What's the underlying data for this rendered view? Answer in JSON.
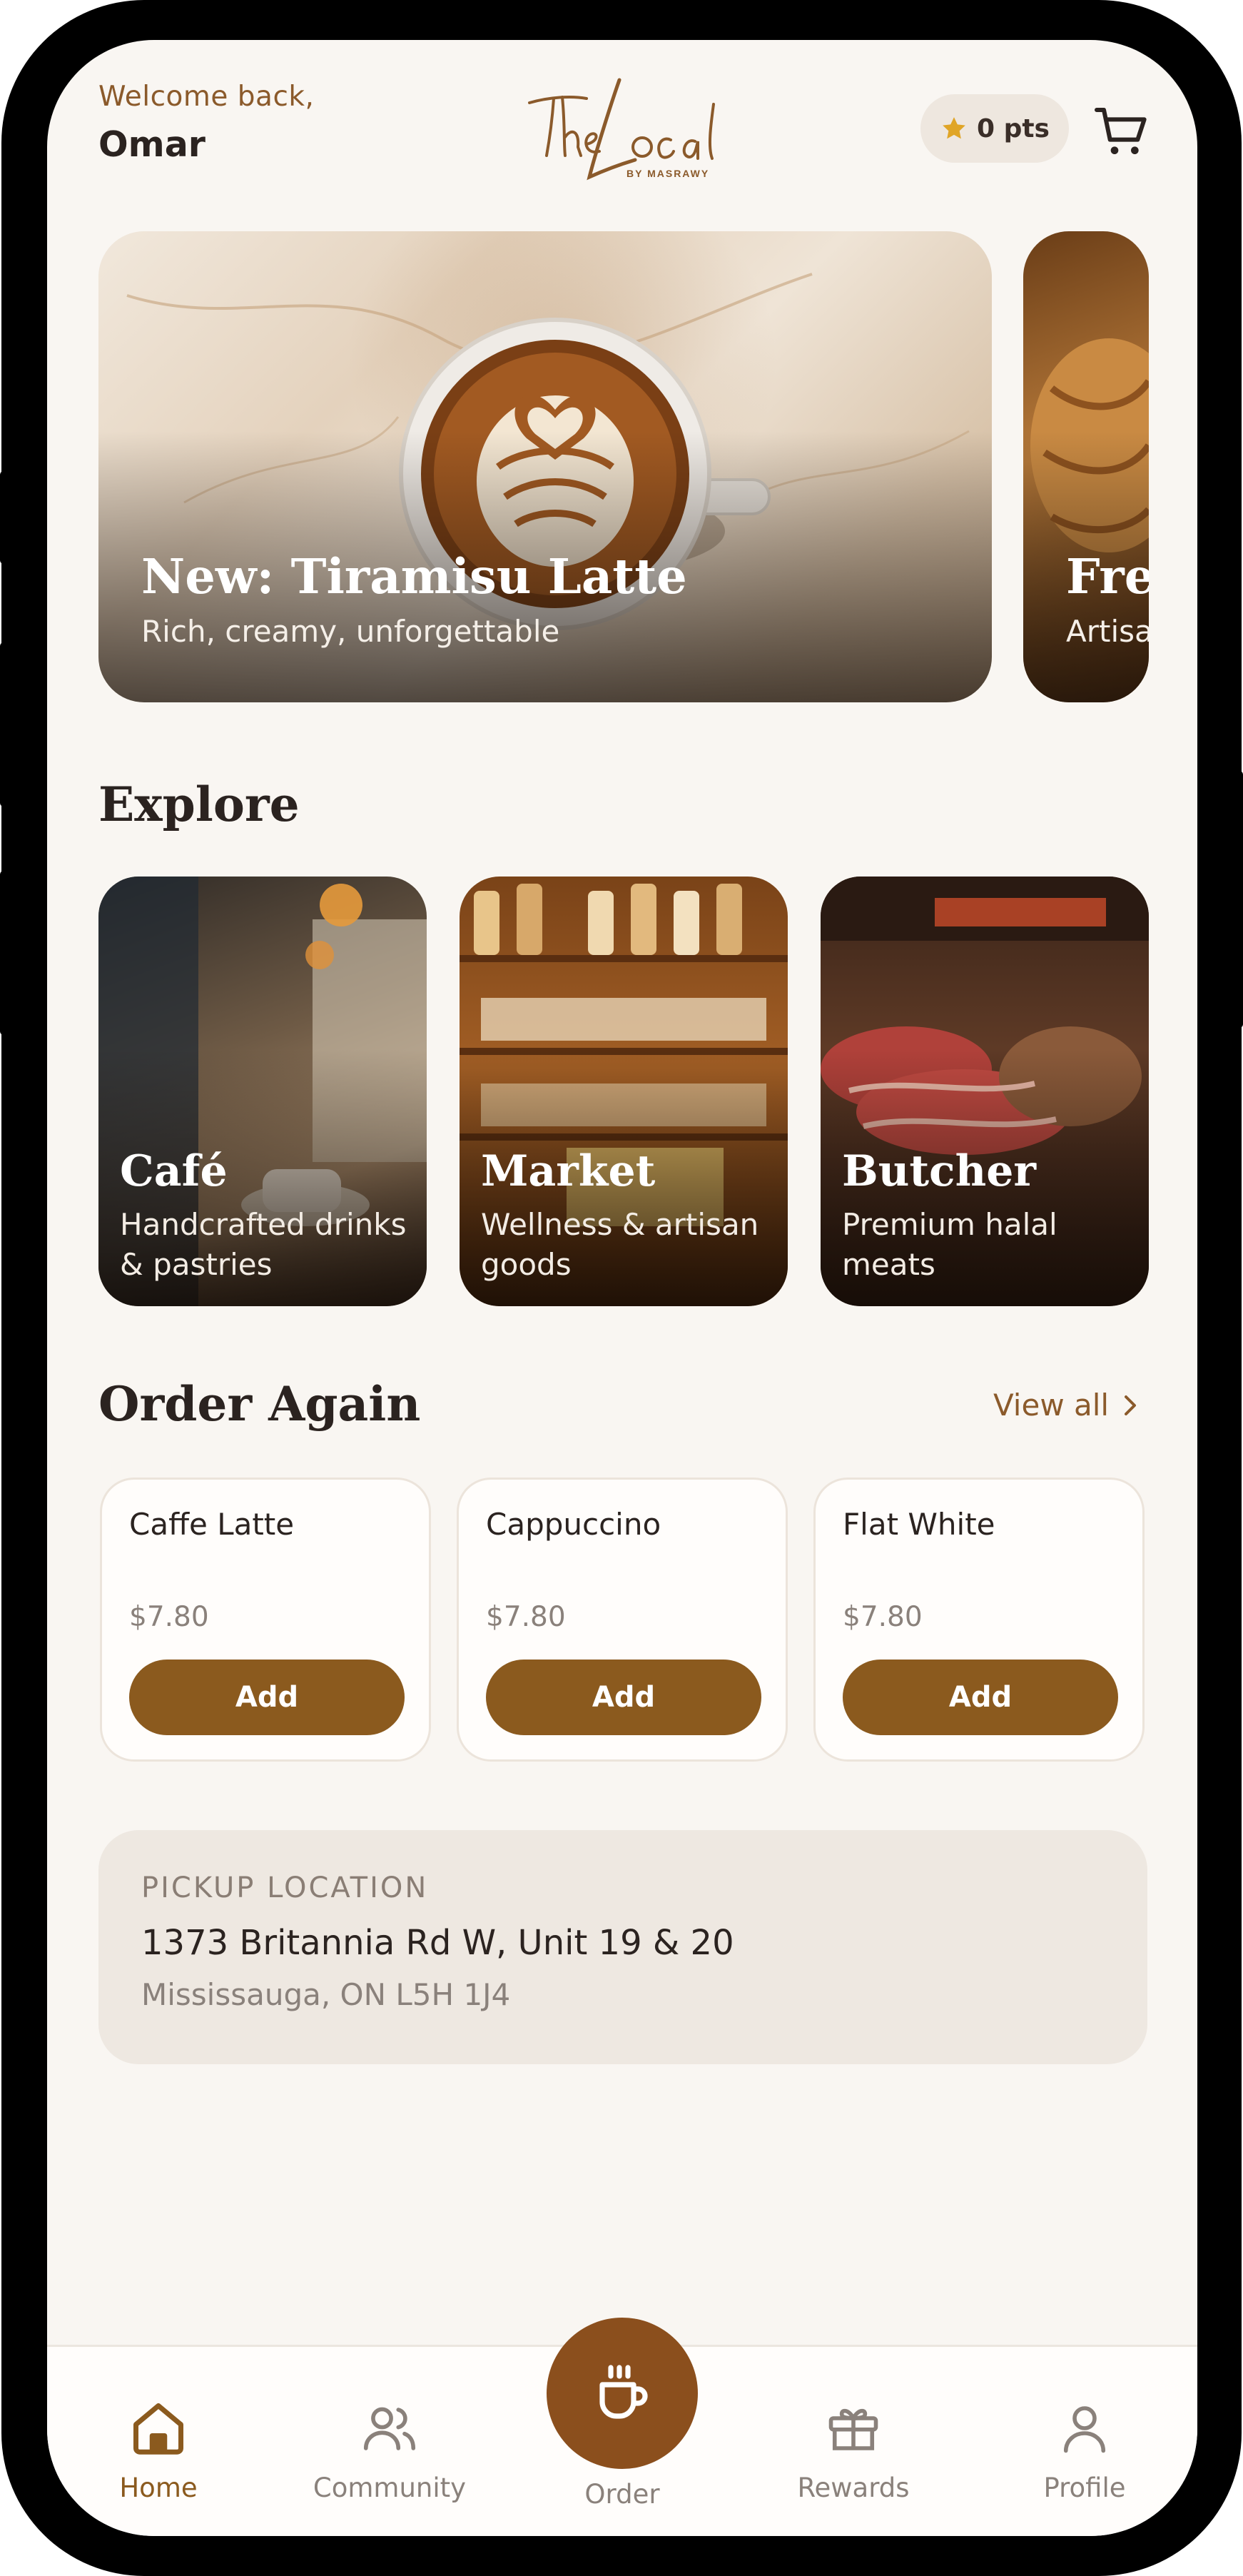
{
  "header": {
    "welcome": "Welcome back,",
    "username": "Omar",
    "logo_text": "The Local",
    "logo_sub": "BY MASRAWY",
    "points": "0 pts"
  },
  "hero": [
    {
      "title": "New: Tiramisu Latte",
      "subtitle": "Rich, creamy, unforgettable"
    },
    {
      "title": "Fres",
      "subtitle": "Artisa"
    }
  ],
  "explore": {
    "heading": "Explore",
    "items": [
      {
        "title": "Café",
        "desc": "Handcrafted drinks & pastries"
      },
      {
        "title": "Market",
        "desc": "Wellness & artisan goods"
      },
      {
        "title": "Butcher",
        "desc": "Premium halal meats"
      }
    ]
  },
  "order_again": {
    "heading": "Order Again",
    "view_all": "View all",
    "items": [
      {
        "name": "Caffe Latte",
        "price": "$7.80",
        "button": "Add"
      },
      {
        "name": "Cappuccino",
        "price": "$7.80",
        "button": "Add"
      },
      {
        "name": "Flat White",
        "price": "$7.80",
        "button": "Add"
      }
    ]
  },
  "pickup": {
    "label": "PICKUP LOCATION",
    "address": "1373 Britannia Rd W, Unit 19 & 20",
    "city": "Mississauga, ON L5H 1J4"
  },
  "nav": {
    "home": "Home",
    "community": "Community",
    "order": "Order",
    "rewards": "Rewards",
    "profile": "Profile"
  },
  "colors": {
    "accent": "#8b5a1e",
    "background": "#f9f6f2",
    "star": "#e0a526"
  },
  "icons": [
    "star-icon",
    "cart-icon",
    "chevron-right-icon",
    "home-icon",
    "community-icon",
    "coffee-cup-icon",
    "gift-icon",
    "profile-icon"
  ]
}
